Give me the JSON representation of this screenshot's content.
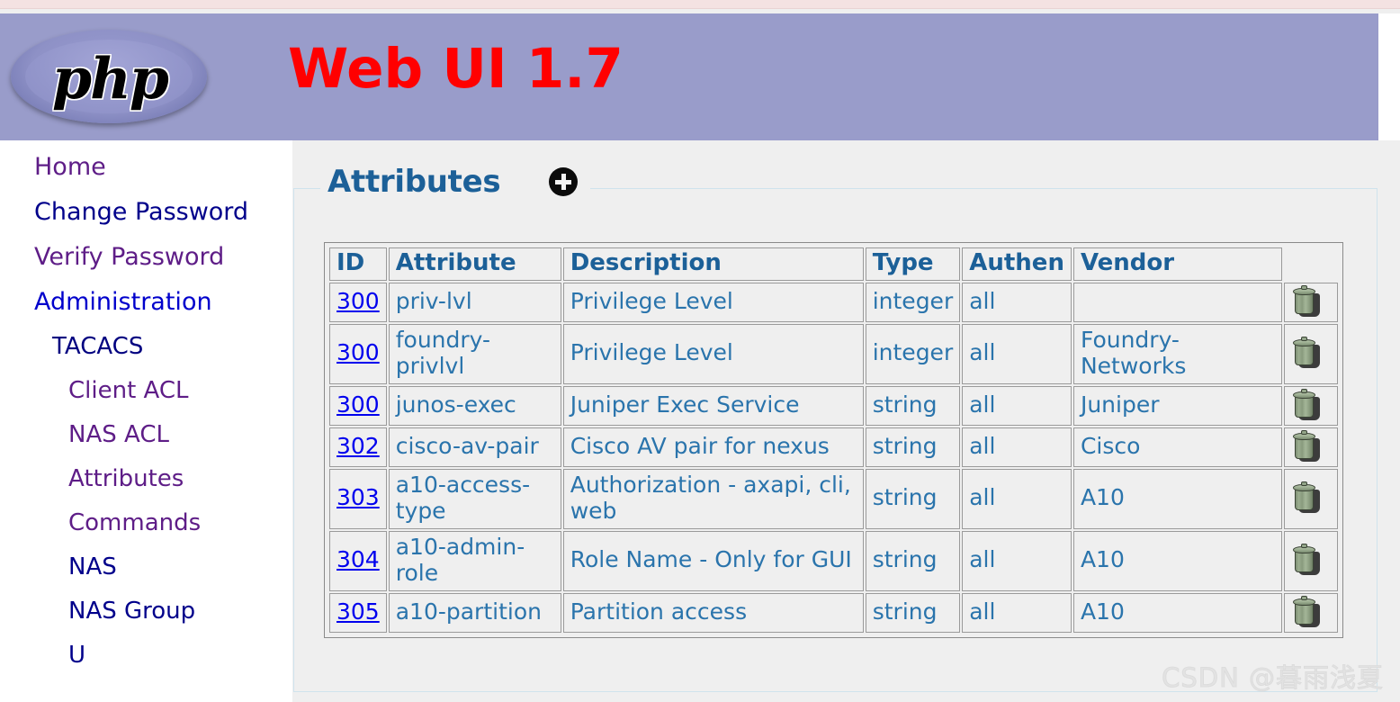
{
  "header": {
    "logo_text": "php",
    "logo_name": "php-logo",
    "title": "Web UI 1.7",
    "banner_color": "#999CCA",
    "title_color": "#FF0000"
  },
  "sidebar": {
    "items": [
      {
        "label": "Home",
        "level": 0,
        "color": "#5E1D87"
      },
      {
        "label": "Change Password",
        "level": 0,
        "color": "#00008B"
      },
      {
        "label": "Verify Password",
        "level": 0,
        "color": "#5E1D87"
      },
      {
        "label": "Administration",
        "level": 0,
        "color": "#0000CC"
      },
      {
        "label": "TACACS",
        "level": 1,
        "color": "#000080"
      },
      {
        "label": "Client ACL",
        "level": 2,
        "color": "#5E1D87"
      },
      {
        "label": "NAS ACL",
        "level": 2,
        "color": "#5E1D87"
      },
      {
        "label": "Attributes",
        "level": 2,
        "color": "#5E1D87"
      },
      {
        "label": "Commands",
        "level": 2,
        "color": "#5E1D87"
      },
      {
        "label": "NAS",
        "level": 2,
        "color": "#00008B"
      },
      {
        "label": "NAS Group",
        "level": 2,
        "color": "#00008B"
      },
      {
        "label": "U",
        "level": 2,
        "color": "#00008B"
      }
    ]
  },
  "main": {
    "legend_title": "Attributes",
    "add_icon": "plus-circle-icon",
    "table": {
      "columns": [
        "ID",
        "Attribute",
        "Description",
        "Type",
        "Authen",
        "Vendor"
      ],
      "delete_icon": "trash-icon",
      "rows": [
        {
          "id": "300",
          "attribute": "priv-lvl",
          "description": "Privilege Level",
          "type": "integer",
          "authen": "all",
          "vendor": ""
        },
        {
          "id": "300",
          "attribute": "foundry-privlvl",
          "description": "Privilege Level",
          "type": "integer",
          "authen": "all",
          "vendor": "Foundry-Networks"
        },
        {
          "id": "300",
          "attribute": "junos-exec",
          "description": "Juniper Exec Service",
          "type": "string",
          "authen": "all",
          "vendor": "Juniper"
        },
        {
          "id": "302",
          "attribute": "cisco-av-pair",
          "description": "Cisco AV pair for nexus",
          "type": "string",
          "authen": "all",
          "vendor": "Cisco"
        },
        {
          "id": "303",
          "attribute": "a10-access-type",
          "description": "Authorization - axapi, cli, web",
          "type": "string",
          "authen": "all",
          "vendor": "A10"
        },
        {
          "id": "304",
          "attribute": "a10-admin-role",
          "description": "Role Name - Only for GUI",
          "type": "string",
          "authen": "all",
          "vendor": "A10"
        },
        {
          "id": "305",
          "attribute": "a10-partition",
          "description": "Partition access",
          "type": "string",
          "authen": "all",
          "vendor": "A10"
        }
      ]
    }
  },
  "watermark": {
    "text": "CSDN @暮雨浅夏"
  }
}
